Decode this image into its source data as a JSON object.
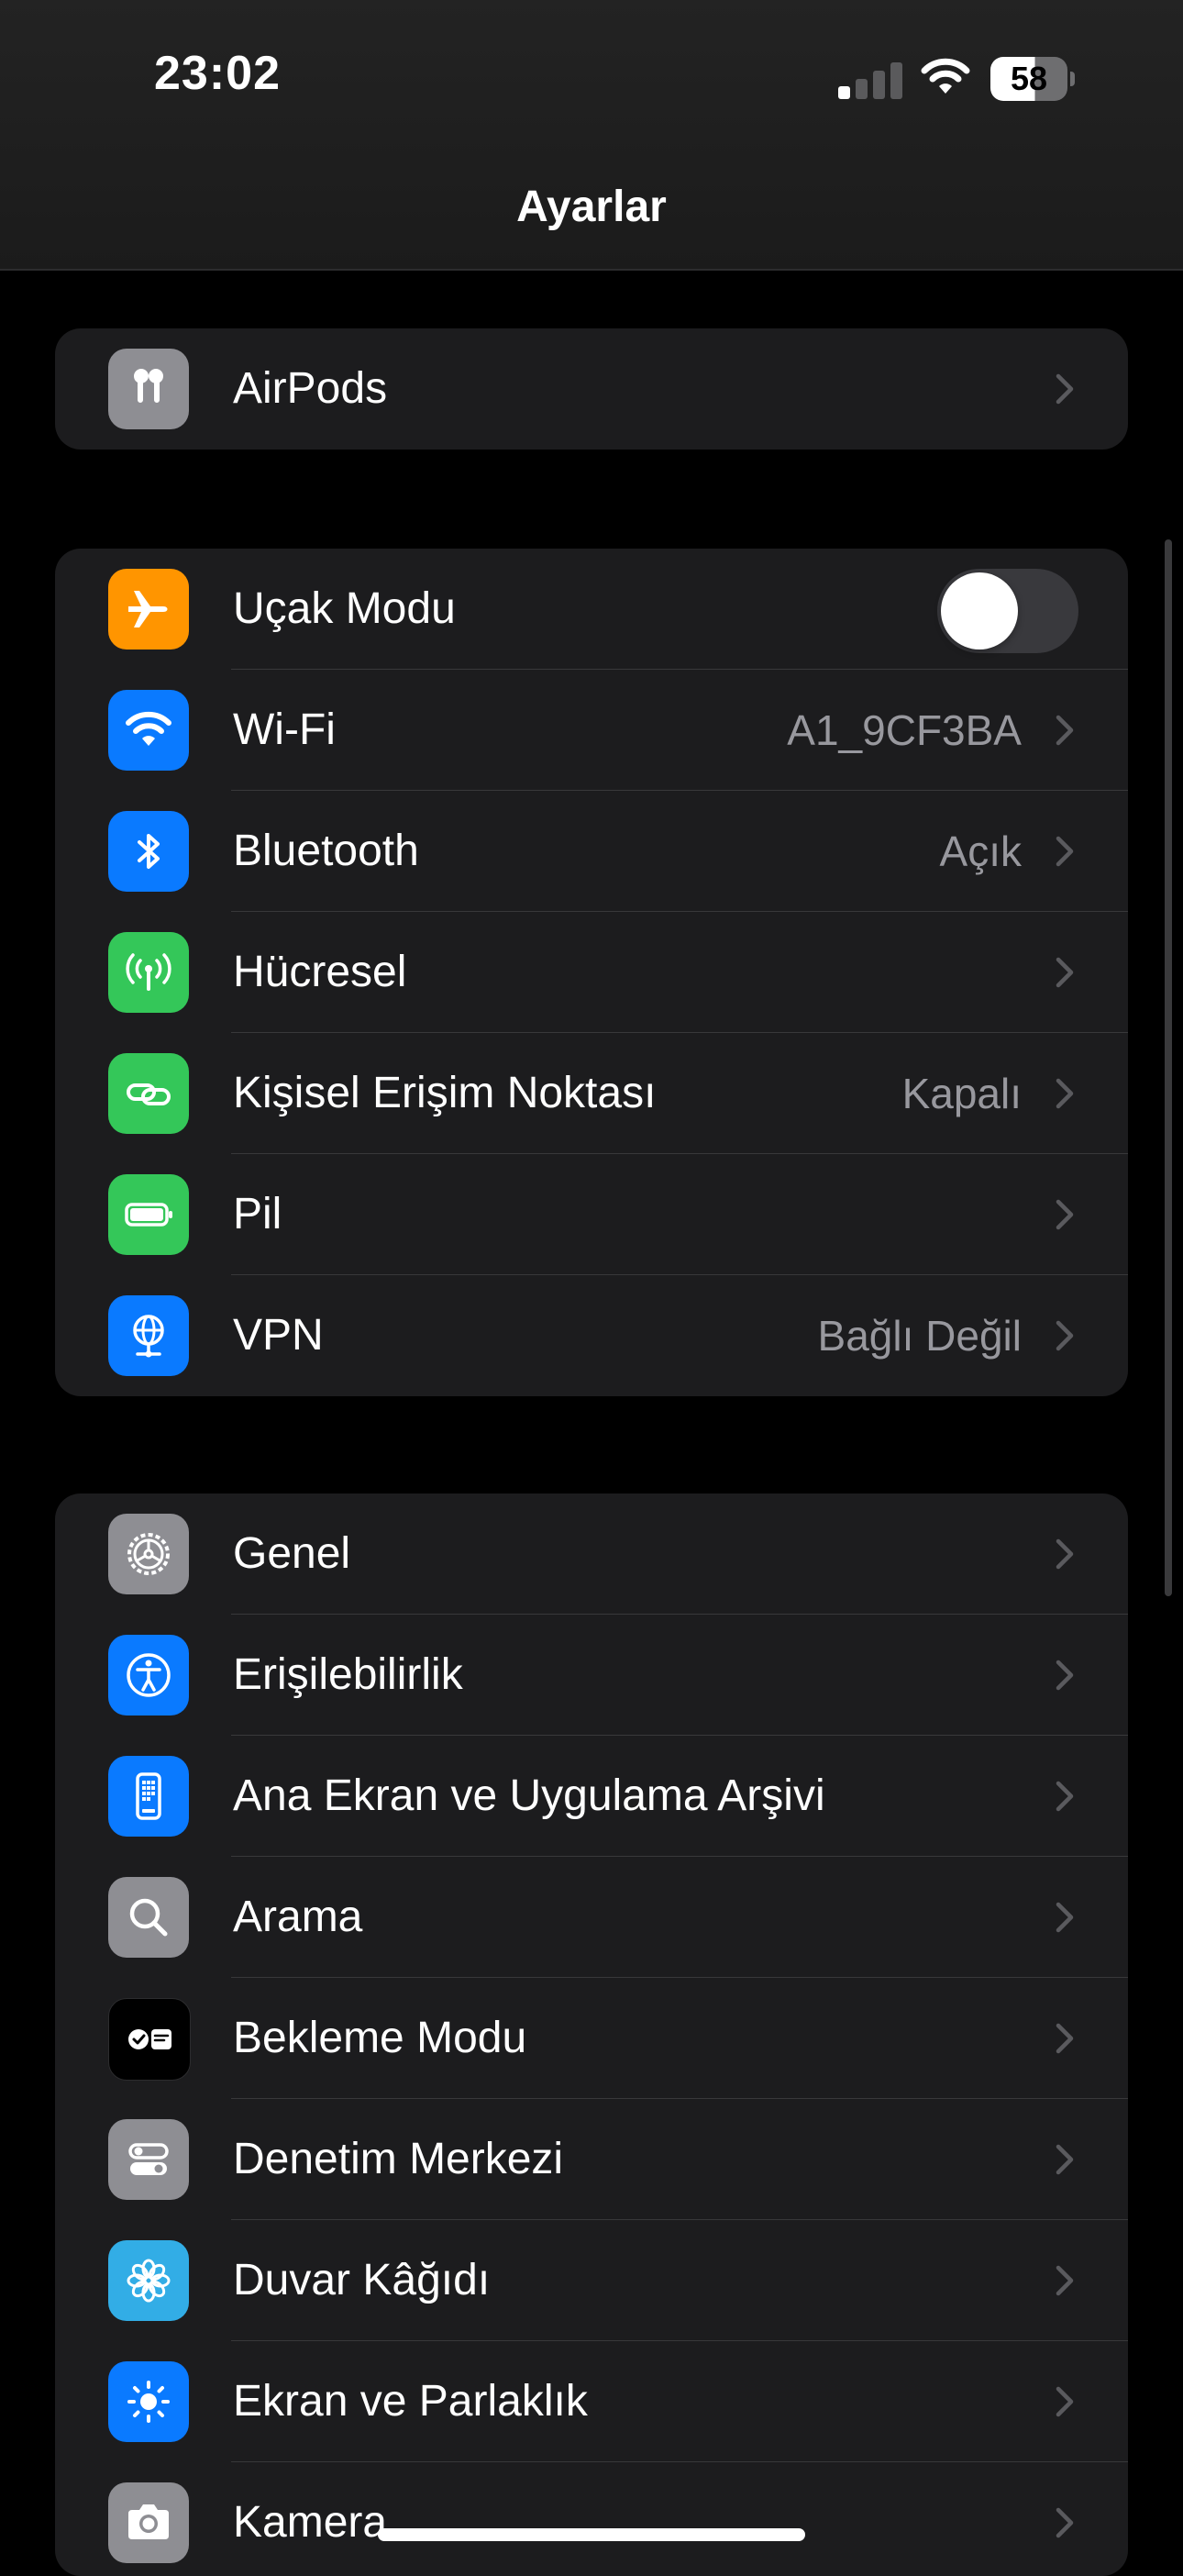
{
  "status_bar": {
    "time": "23:02",
    "battery_percent": "58",
    "signal_bars_active": 1,
    "signal_bars_total": 4
  },
  "header": {
    "title": "Ayarlar"
  },
  "colors": {
    "orange": "#ff9500",
    "blue": "#0a7aff",
    "green": "#34c759",
    "gray": "#8e8e93",
    "black": "#000000",
    "cyan": "#32ade6",
    "toggle_off": "#39393d"
  },
  "group_airpods": {
    "items": [
      {
        "label": "AirPods",
        "icon": "airpods-icon"
      }
    ]
  },
  "group_connectivity": {
    "items": [
      {
        "label": "Uçak Modu",
        "icon": "airplane-icon",
        "toggle": false
      },
      {
        "label": "Wi-Fi",
        "value": "A1_9CF3BA",
        "icon": "wifi-icon"
      },
      {
        "label": "Bluetooth",
        "value": "Açık",
        "icon": "bluetooth-icon"
      },
      {
        "label": "Hücresel",
        "icon": "cellular-antenna-icon"
      },
      {
        "label": "Kişisel Erişim Noktası",
        "value": "Kapalı",
        "icon": "personal-hotspot-icon"
      },
      {
        "label": "Pil",
        "icon": "battery-icon"
      },
      {
        "label": "VPN",
        "value": "Bağlı Değil",
        "icon": "vpn-globe-icon"
      }
    ]
  },
  "group_general": {
    "items": [
      {
        "label": "Genel",
        "icon": "gear-icon"
      },
      {
        "label": "Erişilebilirlik",
        "icon": "accessibility-icon"
      },
      {
        "label": "Ana Ekran ve Uygulama Arşivi",
        "icon": "home-screen-icon"
      },
      {
        "label": "Arama",
        "icon": "search-icon"
      },
      {
        "label": "Bekleme Modu",
        "icon": "standby-icon"
      },
      {
        "label": "Denetim Merkezi",
        "icon": "control-center-icon"
      },
      {
        "label": "Duvar Kâğıdı",
        "icon": "wallpaper-flower-icon"
      },
      {
        "label": "Ekran ve Parlaklık",
        "icon": "brightness-icon"
      },
      {
        "label": "Kamera",
        "icon": "camera-icon"
      }
    ]
  }
}
